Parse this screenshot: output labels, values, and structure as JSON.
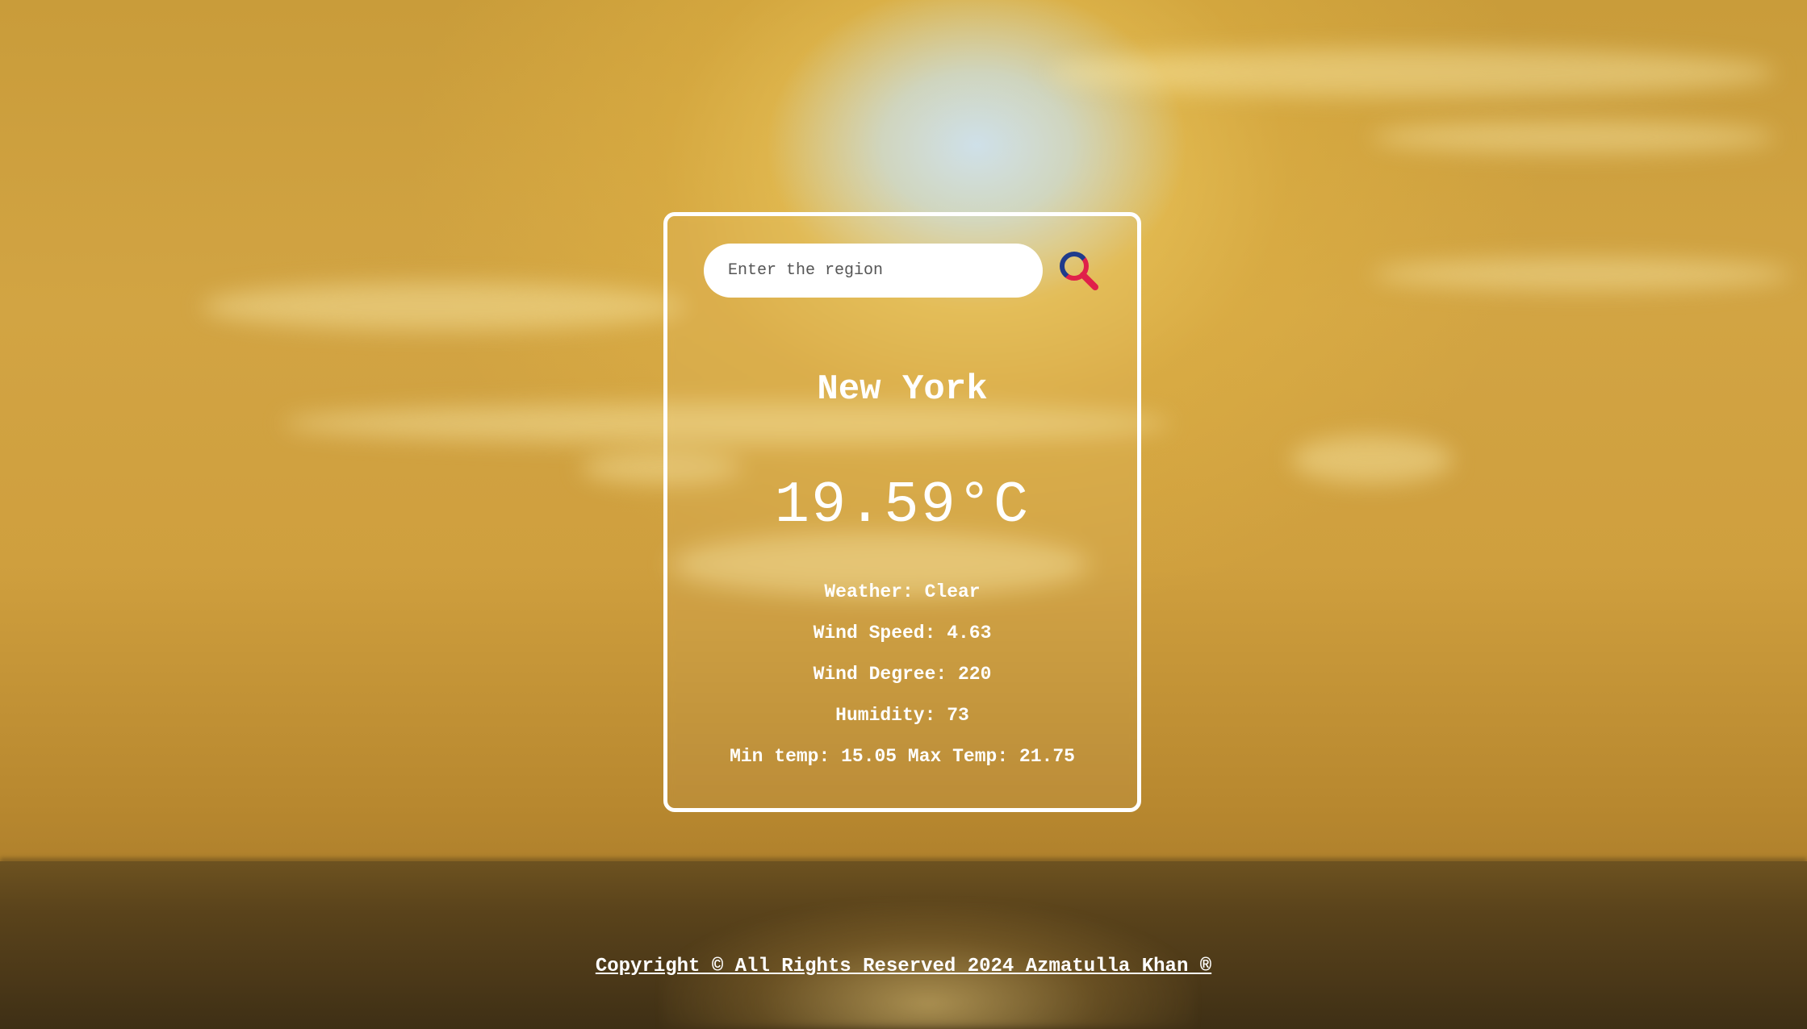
{
  "search": {
    "placeholder": "Enter the region",
    "value": ""
  },
  "weather": {
    "city": "New York",
    "temperature": "19.59°C",
    "condition": "Weather: Clear",
    "wind_speed": "Wind Speed: 4.63",
    "wind_degree": "Wind Degree: 220",
    "humidity": "Humidity: 73",
    "min_max": "Min temp: 15.05 Max Temp: 21.75"
  },
  "footer": {
    "copyright": "Copyright © All Rights Reserved 2024 Azmatulla Khan ®"
  },
  "icons": {
    "search": "search-icon"
  },
  "colors": {
    "search_icon_ring": "#1f3b8c",
    "search_icon_accent": "#e0204a",
    "text": "#ffffff"
  }
}
